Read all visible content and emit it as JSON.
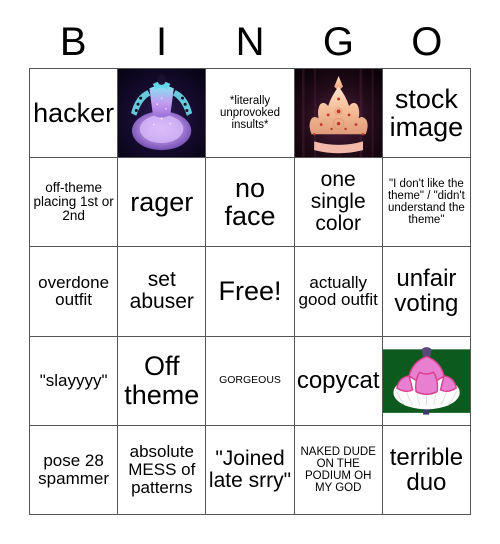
{
  "card": {
    "title": "BINGO",
    "header_letters": [
      "B",
      "I",
      "N",
      "G",
      "O"
    ],
    "grid_size": 5,
    "colors": {
      "background": "#ffffff",
      "text": "#000000",
      "border": "#555555",
      "image_ballerina_bg": "#0a0616",
      "image_crown_bg": "#120308",
      "image_flower_bg": "#0d5a1e"
    },
    "cells": [
      [
        {
          "type": "text",
          "text": "hacker",
          "size": "xxl"
        },
        {
          "type": "image",
          "name": "glowing-blue-purple-tutu-ballerina",
          "alt": "glowing blue and purple illuminated ballerina tutu on dark background"
        },
        {
          "type": "text",
          "text": "*literally unprovoked insults*",
          "size": "xs"
        },
        {
          "type": "image",
          "name": "ornate-flame-crown-tiara",
          "alt": "ornate gold flame shaped crown tiara with red gems on dark background"
        },
        {
          "type": "text",
          "text": "stock image",
          "size": "xxl"
        }
      ],
      [
        {
          "type": "text",
          "text": "off-theme placing 1st or 2nd",
          "size": "s"
        },
        {
          "type": "text",
          "text": "rager",
          "size": "xxl"
        },
        {
          "type": "text",
          "text": "no face",
          "size": "xxl"
        },
        {
          "type": "text",
          "text": "one single color",
          "size": "l"
        },
        {
          "type": "text",
          "text": "\"I don't like the theme\" / \"didn't understand the theme\"",
          "size": "xs"
        }
      ],
      [
        {
          "type": "text",
          "text": "overdone outfit",
          "size": "m"
        },
        {
          "type": "text",
          "text": "set abuser",
          "size": "l"
        },
        {
          "type": "text",
          "text": "Free!",
          "size": "xxl"
        },
        {
          "type": "text",
          "text": "actually good outfit",
          "size": "m"
        },
        {
          "type": "text",
          "text": "unfair voting",
          "size": "xl"
        }
      ],
      [
        {
          "type": "text",
          "text": "\"slayyyy\"",
          "size": "m"
        },
        {
          "type": "text",
          "text": "Off theme",
          "size": "xxl"
        },
        {
          "type": "text",
          "text": "GORGEOUS",
          "size": "xxs"
        },
        {
          "type": "text",
          "text": "copycat",
          "size": "xl"
        },
        {
          "type": "image",
          "name": "pink-white-flower-tutu-costume",
          "alt": "pink and white petal flower tutu costume on green background"
        }
      ],
      [
        {
          "type": "text",
          "text": "pose 28 spammer",
          "size": "m"
        },
        {
          "type": "text",
          "text": "absolute MESS of patterns",
          "size": "m"
        },
        {
          "type": "text",
          "text": "\"Joined late srry\"",
          "size": "l"
        },
        {
          "type": "text",
          "text": "NAKED DUDE ON THE PODIUM OH MY GOD",
          "size": "xs"
        },
        {
          "type": "text",
          "text": "terrible duo",
          "size": "xl"
        }
      ]
    ]
  }
}
